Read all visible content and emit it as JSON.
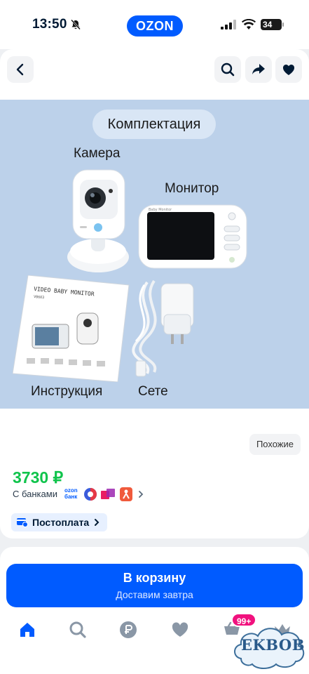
{
  "status_bar": {
    "time": "13:50",
    "battery": "34"
  },
  "brand": {
    "logo_text": "OZON"
  },
  "header": {
    "back_icon": "chevron-left-icon",
    "search_icon": "search-icon",
    "share_icon": "share-icon",
    "favorite_icon": "heart-icon"
  },
  "product_image": {
    "tag": "Комплектация",
    "labels": {
      "camera": "Камера",
      "monitor": "Монитор",
      "instruction": "Инструкция",
      "adapter": "Сете"
    },
    "manual_title": "VIDEO BABY MONITOR",
    "manual_model": "VB603",
    "monitor_brand": "Baby Monitor"
  },
  "similar_button": "Похожие",
  "price": {
    "value": "3730 ₽",
    "banks_label": "С банками",
    "bank_badge": "ozon банк"
  },
  "postpay": {
    "label": "Постоплата"
  },
  "cart_button": {
    "title": "В корзину",
    "subtitle": "Доставим завтра"
  },
  "bottom_nav": {
    "items": [
      "home-icon",
      "search-icon",
      "ruble-icon",
      "heart-icon",
      "cart-icon",
      "crown-icon"
    ],
    "cart_badge": "99+"
  },
  "watermark": "EKBOB",
  "colors": {
    "brand_blue": "#005bff",
    "price_green": "#10c44c",
    "badge_pink": "#f1117e"
  }
}
